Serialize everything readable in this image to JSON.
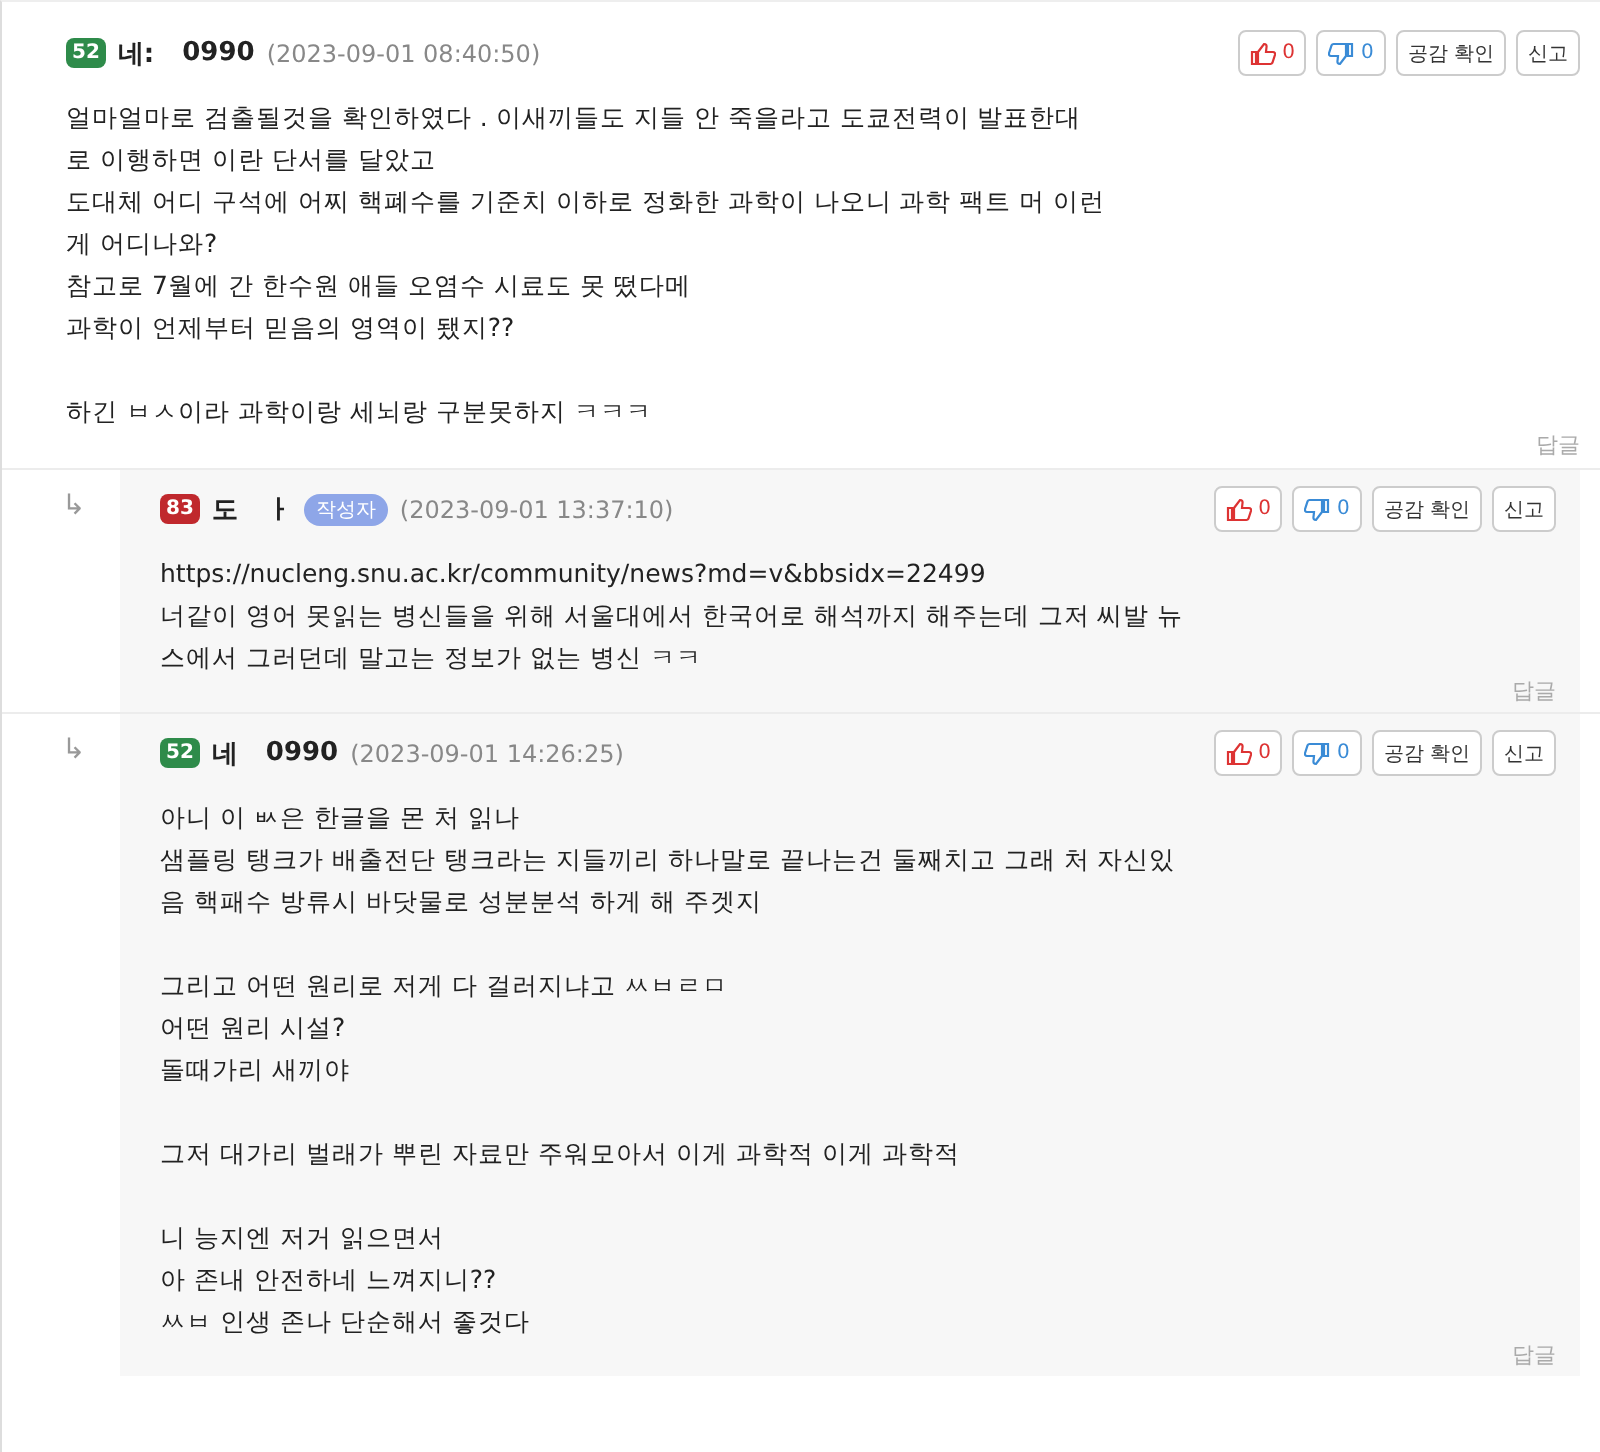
{
  "comments": [
    {
      "reply": false,
      "level_badge": "52",
      "color": "#2e8b4a",
      "name_parts": [
        "네:",
        "0990"
      ],
      "time": "(2023-09-01 08:40:50)",
      "likes": "0",
      "dislikes": "0",
      "check_label": "공감 확인",
      "report_label": "신고",
      "reply_label": "답글",
      "paragraphs": [
        [
          "얼마얼마로 검출될것을 확인하였다 . 이새끼들도 지들 안 죽을라고 도쿄전력이 발표한대",
          "로 이행하면 이란 단서를 달았고",
          "도대체 어디 구석에 어찌 핵폐수를 기준치 이하로 정화한 과학이 나오니 과학 팩트 머 이런",
          "게 어디나와?",
          " 참고로 7월에 간 한수원 애들 오염수 시료도 못 떴다메",
          "과학이 언제부터 믿음의 영역이 됐지??"
        ],
        [
          "하긴 ㅂㅅ이라 과학이랑 세뇌랑 구분못하지 ㅋㅋㅋ"
        ]
      ]
    },
    {
      "reply": true,
      "reply_arrow": "↳",
      "level_badge": "83",
      "color": "#c0282d",
      "name_parts": [
        "도",
        "ㅏ"
      ],
      "author_tag": "작성자",
      "time": "(2023-09-01 13:37:10)",
      "likes": "0",
      "dislikes": "0",
      "check_label": "공감 확인",
      "report_label": "신고",
      "reply_label": "답글",
      "paragraphs": [
        [
          "https://nucleng.snu.ac.kr/community/news?md=v&bbsidx=22499",
          "너같이 영어 못읽는 병신들을 위해 서울대에서 한국어로 해석까지 해주는데 그저 씨발 뉴",
          "스에서 그러던데 말고는 정보가 없는 병신 ㅋㅋ"
        ]
      ]
    },
    {
      "reply": true,
      "reply_arrow": "↳",
      "level_badge": "52",
      "color": "#2e8b4a",
      "name_parts": [
        "네",
        "0990"
      ],
      "time": "(2023-09-01 14:26:25)",
      "likes": "0",
      "dislikes": "0",
      "check_label": "공감 확인",
      "report_label": "신고",
      "reply_label": "답글",
      "paragraphs": [
        [
          "아니 이 ㅄ은 한글을 몬 처 읽나",
          "샘플링 탱크가 배출전단 탱크라는 지들끼리 하나말로 끝나는건 둘째치고 그래 처 자신있",
          "음 핵패수 방류시 바닷물로 성분분석 하게 해 주겟지"
        ],
        [
          "그리고 어떤 원리로 저게 다 걸러지냐고 ㅆㅂㄹㅁ",
          "어떤 원리 시설?",
          "돌때가리 새끼야"
        ],
        [
          "그저 대가리 벌래가 뿌린 자료만 주워모아서 이게 과학적 이게 과학적"
        ],
        [
          "니 능지엔 저거 읽으면서",
          "아 존내 안전하네 느껴지니??",
          "ㅆㅂ 인생 존나 단순해서 좋것다"
        ]
      ]
    }
  ]
}
